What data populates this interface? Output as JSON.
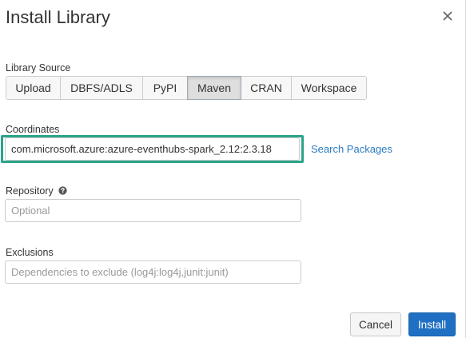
{
  "dialog": {
    "title": "Install Library",
    "close_icon": "close-icon"
  },
  "library_source": {
    "label": "Library Source",
    "options": [
      "Upload",
      "DBFS/ADLS",
      "PyPI",
      "Maven",
      "CRAN",
      "Workspace"
    ],
    "selected": "Maven"
  },
  "coordinates": {
    "label": "Coordinates",
    "value": "com.microsoft.azure:azure-eventhubs-spark_2.12:2.3.18",
    "search_link": "Search Packages",
    "highlight_color": "#2aa489"
  },
  "repository": {
    "label": "Repository",
    "help_icon": "question-circle-icon",
    "placeholder": "Optional",
    "value": ""
  },
  "exclusions": {
    "label": "Exclusions",
    "placeholder": "Dependencies to exclude (log4j:log4j,junit:junit)",
    "value": ""
  },
  "footer": {
    "cancel_label": "Cancel",
    "install_label": "Install",
    "primary_color": "#1f6fc3"
  }
}
